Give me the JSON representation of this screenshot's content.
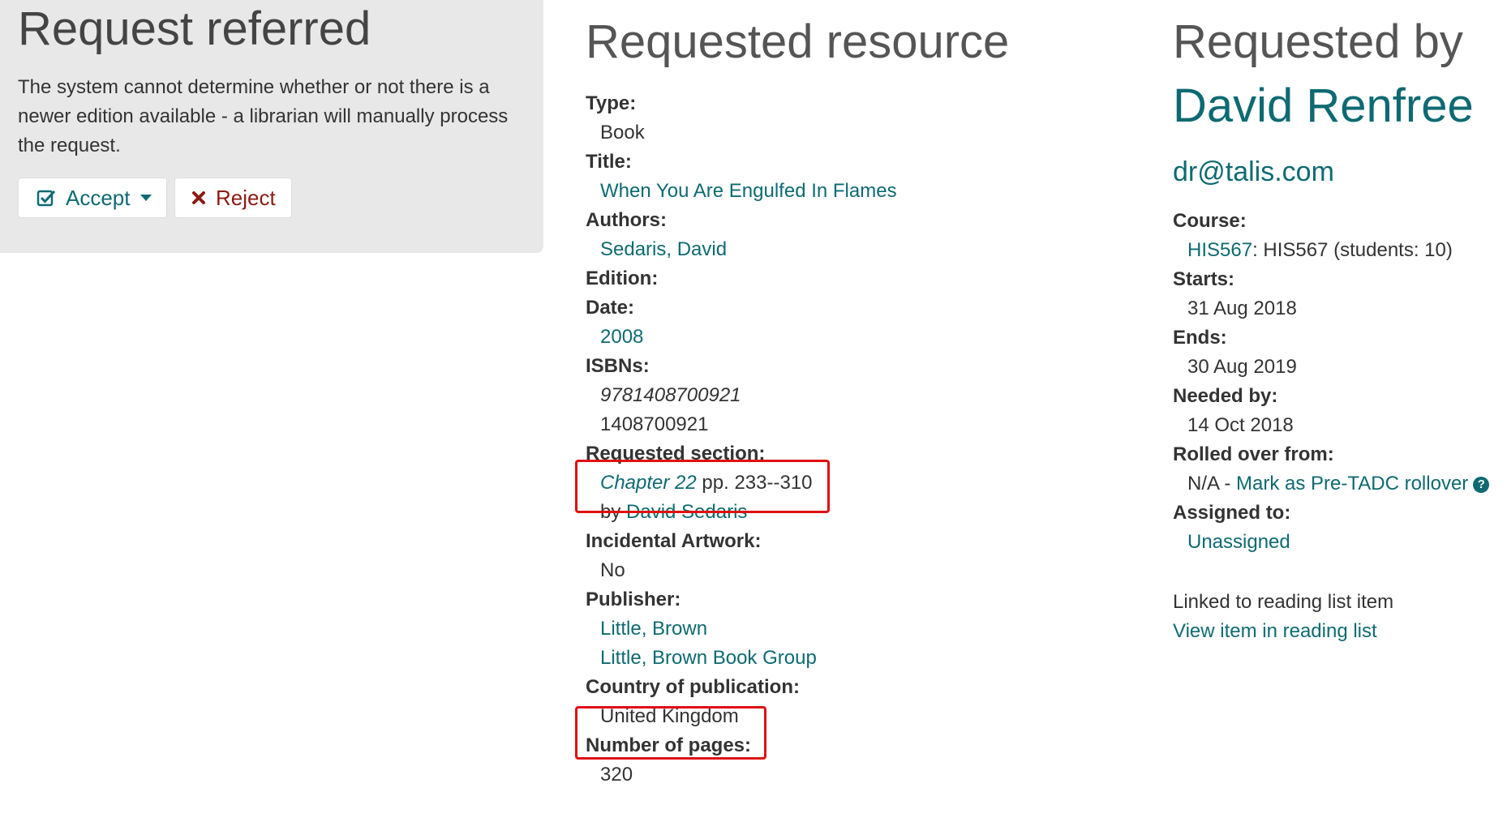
{
  "referral": {
    "title": "Request referred",
    "message": "The system cannot determine whether or not there is a newer edition available - a librarian will manually process the request.",
    "accept_label": "Accept",
    "reject_label": "Reject"
  },
  "resource": {
    "heading": "Requested resource",
    "type_label": "Type:",
    "type": "Book",
    "title_label": "Title:",
    "title": "When You Are Engulfed In Flames",
    "authors_label": "Authors:",
    "author": "Sedaris, David",
    "edition_label": "Edition:",
    "date_label": "Date:",
    "date": "2008",
    "isbns_label": "ISBNs:",
    "isbn1": "9781408700921",
    "isbn2": "1408700921",
    "section_label": "Requested section:",
    "section_name": "Chapter 22",
    "section_pages": " pp. 233--310",
    "section_by": "by ",
    "section_author": "David Sedaris",
    "artwork_label": "Incidental Artwork:",
    "artwork": "No",
    "publisher_label": "Publisher:",
    "publisher1": "Little, Brown",
    "publisher2": "Little, Brown Book Group",
    "country_label": "Country of publication:",
    "country": "United Kingdom",
    "pages_label": "Number of pages:",
    "pages": "320"
  },
  "requester": {
    "heading": "Requested by",
    "name": "David Renfree",
    "email": "dr@talis.com",
    "course_label": "Course:",
    "course_code": "HIS567",
    "course_desc": ": HIS567 (students: 10)",
    "starts_label": "Starts:",
    "starts": "31 Aug 2018",
    "ends_label": "Ends:",
    "ends": "30 Aug 2019",
    "needed_label": "Needed by:",
    "needed": "14 Oct 2018",
    "rolled_label": "Rolled over from:",
    "rolled_prefix": "N/A - ",
    "rolled_link": "Mark as Pre-TADC rollover",
    "assigned_label": "Assigned to:",
    "assigned": "Unassigned",
    "linked_text": "Linked to reading list item",
    "linked_link": "View item in reading list"
  },
  "colors": {
    "accent": "#0e6a72",
    "reject": "#8a1b12",
    "highlight": "#e01010",
    "panel": "#e8e8e8"
  }
}
